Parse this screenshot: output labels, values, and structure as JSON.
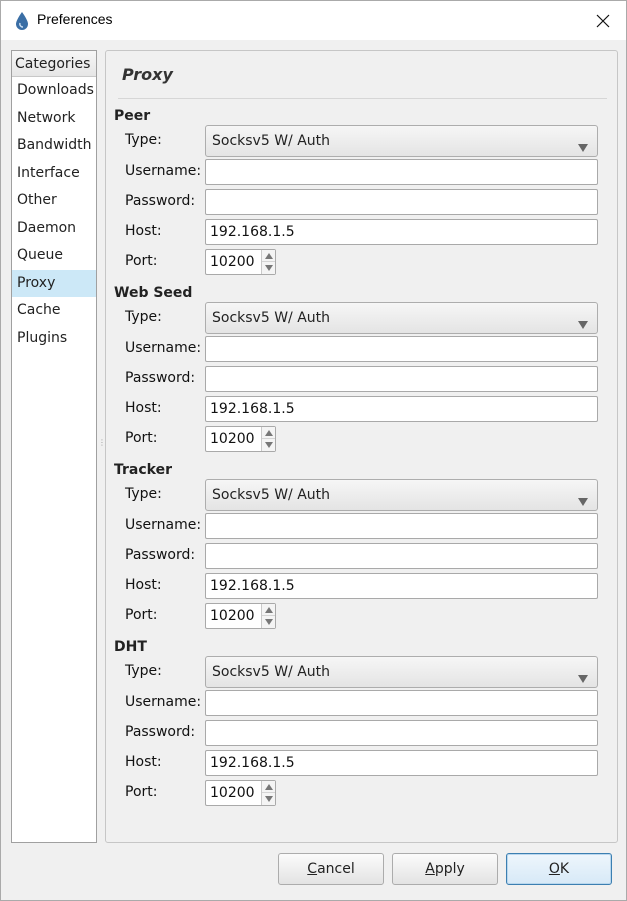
{
  "window": {
    "title": "Preferences"
  },
  "categories": {
    "header": "Categories",
    "items": [
      {
        "label": "Downloads",
        "selected": false
      },
      {
        "label": "Network",
        "selected": false
      },
      {
        "label": "Bandwidth",
        "selected": false
      },
      {
        "label": "Interface",
        "selected": false
      },
      {
        "label": "Other",
        "selected": false
      },
      {
        "label": "Daemon",
        "selected": false
      },
      {
        "label": "Queue",
        "selected": false
      },
      {
        "label": "Proxy",
        "selected": true
      },
      {
        "label": "Cache",
        "selected": false
      },
      {
        "label": "Plugins",
        "selected": false
      }
    ]
  },
  "panel": {
    "title": "Proxy",
    "labels": {
      "type": "Type:",
      "username": "Username:",
      "password": "Password:",
      "host": "Host:",
      "port": "Port:"
    },
    "groups": [
      {
        "heading": "Peer",
        "type": "Socksv5 W/ Auth",
        "username": "",
        "password": "",
        "host": "192.168.1.5",
        "port": "10200"
      },
      {
        "heading": "Web Seed",
        "type": "Socksv5 W/ Auth",
        "username": "",
        "password": "",
        "host": "192.168.1.5",
        "port": "10200"
      },
      {
        "heading": "Tracker",
        "type": "Socksv5 W/ Auth",
        "username": "",
        "password": "",
        "host": "192.168.1.5",
        "port": "10200"
      },
      {
        "heading": "DHT",
        "type": "Socksv5 W/ Auth",
        "username": "",
        "password": "",
        "host": "192.168.1.5",
        "port": "10200"
      }
    ]
  },
  "buttons": {
    "cancel": {
      "mnemonic": "C",
      "rest": "ancel"
    },
    "apply": {
      "mnemonic": "A",
      "rest": "pply"
    },
    "ok": {
      "mnemonic": "O",
      "rest": "K"
    }
  },
  "colors": {
    "selected_category": "#cce8f7",
    "ok_border": "#3c7fb1"
  }
}
